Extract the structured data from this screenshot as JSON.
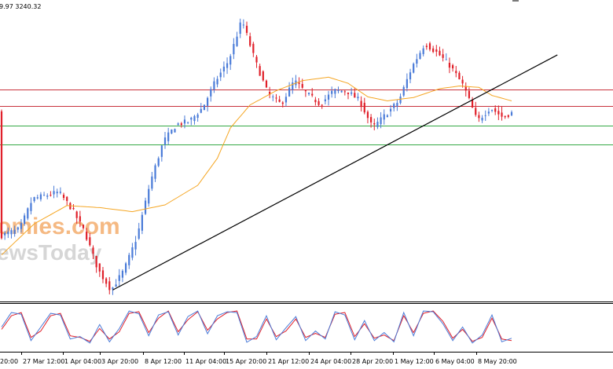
{
  "header": {
    "ohlc_text": "9.97 3240.32"
  },
  "watermark": {
    "line1": "omies.com",
    "line2": "ewsToday"
  },
  "colors": {
    "bull": "#4a7bd8",
    "bear": "#e0202a",
    "ma": "#f5a623",
    "trendline": "#000000",
    "resistance": "#c8323c",
    "support": "#35a845",
    "stoch_k": "#4a7bd8",
    "stoch_d": "#e0202a",
    "watermark": "#f2a25a"
  },
  "chart_data": {
    "type": "candlestick",
    "x_labels": [
      "20:00",
      "27 Mar 12:00",
      "1 Apr 04:00",
      "3 Apr 20:00",
      "8 Apr 12:00",
      "11 Apr 04:00",
      "15 Apr 20:00",
      "21 Apr 12:00",
      "24 Apr 04:00",
      "28 Apr 20:00",
      "1 May 12:00",
      "6 May 04:00",
      "8 May 20:00"
    ],
    "ylim": [
      2980,
      3410
    ],
    "anchors": [
      [
        0,
        3070
      ],
      [
        6,
        3080
      ],
      [
        10,
        3125
      ],
      [
        14,
        3130
      ],
      [
        18,
        3135
      ],
      [
        22,
        3110
      ],
      [
        26,
        3075
      ],
      [
        30,
        3020
      ],
      [
        34,
        2990
      ],
      [
        38,
        3020
      ],
      [
        42,
        3070
      ],
      [
        46,
        3150
      ],
      [
        50,
        3210
      ],
      [
        54,
        3235
      ],
      [
        58,
        3240
      ],
      [
        62,
        3260
      ],
      [
        66,
        3300
      ],
      [
        70,
        3330
      ],
      [
        74,
        3390
      ],
      [
        78,
        3330
      ],
      [
        82,
        3280
      ],
      [
        86,
        3265
      ],
      [
        90,
        3300
      ],
      [
        94,
        3280
      ],
      [
        98,
        3265
      ],
      [
        102,
        3285
      ],
      [
        106,
        3285
      ],
      [
        110,
        3270
      ],
      [
        114,
        3230
      ],
      [
        118,
        3250
      ],
      [
        122,
        3270
      ],
      [
        126,
        3320
      ],
      [
        130,
        3355
      ],
      [
        134,
        3340
      ],
      [
        138,
        3320
      ],
      [
        142,
        3290
      ],
      [
        146,
        3240
      ],
      [
        150,
        3260
      ],
      [
        154,
        3245
      ],
      [
        156,
        3252
      ]
    ],
    "ma_anchors": [
      [
        0,
        3042
      ],
      [
        10,
        3088
      ],
      [
        20,
        3115
      ],
      [
        30,
        3112
      ],
      [
        40,
        3106
      ],
      [
        50,
        3116
      ],
      [
        60,
        3145
      ],
      [
        66,
        3185
      ],
      [
        70,
        3230
      ],
      [
        76,
        3264
      ],
      [
        84,
        3285
      ],
      [
        92,
        3300
      ],
      [
        100,
        3305
      ],
      [
        106,
        3296
      ],
      [
        112,
        3276
      ],
      [
        118,
        3270
      ],
      [
        126,
        3275
      ],
      [
        134,
        3288
      ],
      [
        140,
        3292
      ],
      [
        146,
        3290
      ],
      [
        150,
        3278
      ],
      [
        156,
        3270
      ]
    ],
    "horizontal_lines": [
      {
        "kind": "resistance",
        "value": 3287
      },
      {
        "kind": "resistance",
        "value": 3262
      },
      {
        "kind": "support",
        "value": 3233
      },
      {
        "kind": "support",
        "value": 3206
      }
    ],
    "trendline": [
      [
        34,
        2990
      ],
      [
        170,
        3338
      ]
    ],
    "oscillator": {
      "ylim": [
        0,
        100
      ],
      "k_anchors": [
        [
          0,
          52
        ],
        [
          3,
          88
        ],
        [
          6,
          84
        ],
        [
          9,
          18
        ],
        [
          12,
          52
        ],
        [
          15,
          86
        ],
        [
          18,
          82
        ],
        [
          21,
          22
        ],
        [
          24,
          28
        ],
        [
          27,
          12
        ],
        [
          30,
          58
        ],
        [
          33,
          15
        ],
        [
          36,
          48
        ],
        [
          39,
          92
        ],
        [
          42,
          85
        ],
        [
          45,
          30
        ],
        [
          48,
          82
        ],
        [
          51,
          90
        ],
        [
          54,
          32
        ],
        [
          57,
          78
        ],
        [
          60,
          92
        ],
        [
          63,
          35
        ],
        [
          66,
          80
        ],
        [
          69,
          90
        ],
        [
          72,
          88
        ],
        [
          75,
          14
        ],
        [
          78,
          28
        ],
        [
          81,
          80
        ],
        [
          84,
          20
        ],
        [
          87,
          50
        ],
        [
          90,
          78
        ],
        [
          93,
          18
        ],
        [
          96,
          42
        ],
        [
          99,
          22
        ],
        [
          102,
          90
        ],
        [
          105,
          82
        ],
        [
          108,
          20
        ],
        [
          111,
          68
        ],
        [
          114,
          18
        ],
        [
          117,
          38
        ],
        [
          120,
          15
        ],
        [
          123,
          88
        ],
        [
          126,
          30
        ],
        [
          129,
          92
        ],
        [
          132,
          90
        ],
        [
          135,
          60
        ],
        [
          138,
          18
        ],
        [
          141,
          52
        ],
        [
          144,
          12
        ],
        [
          147,
          32
        ],
        [
          150,
          82
        ],
        [
          153,
          15
        ],
        [
          156,
          24
        ]
      ],
      "d_anchors": [
        [
          0,
          46
        ],
        [
          3,
          80
        ],
        [
          6,
          88
        ],
        [
          9,
          26
        ],
        [
          12,
          42
        ],
        [
          15,
          80
        ],
        [
          18,
          86
        ],
        [
          21,
          30
        ],
        [
          24,
          26
        ],
        [
          27,
          16
        ],
        [
          30,
          48
        ],
        [
          33,
          22
        ],
        [
          36,
          40
        ],
        [
          39,
          86
        ],
        [
          42,
          90
        ],
        [
          45,
          38
        ],
        [
          48,
          74
        ],
        [
          51,
          92
        ],
        [
          54,
          40
        ],
        [
          57,
          70
        ],
        [
          60,
          90
        ],
        [
          63,
          44
        ],
        [
          66,
          72
        ],
        [
          69,
          88
        ],
        [
          72,
          92
        ],
        [
          75,
          22
        ],
        [
          78,
          22
        ],
        [
          81,
          72
        ],
        [
          84,
          28
        ],
        [
          87,
          42
        ],
        [
          90,
          72
        ],
        [
          93,
          26
        ],
        [
          96,
          36
        ],
        [
          99,
          26
        ],
        [
          102,
          84
        ],
        [
          105,
          88
        ],
        [
          108,
          28
        ],
        [
          111,
          60
        ],
        [
          114,
          24
        ],
        [
          117,
          32
        ],
        [
          120,
          18
        ],
        [
          123,
          80
        ],
        [
          126,
          38
        ],
        [
          129,
          86
        ],
        [
          132,
          92
        ],
        [
          135,
          66
        ],
        [
          138,
          24
        ],
        [
          141,
          46
        ],
        [
          144,
          16
        ],
        [
          147,
          26
        ],
        [
          150,
          74
        ],
        [
          153,
          22
        ],
        [
          156,
          18
        ]
      ]
    }
  }
}
